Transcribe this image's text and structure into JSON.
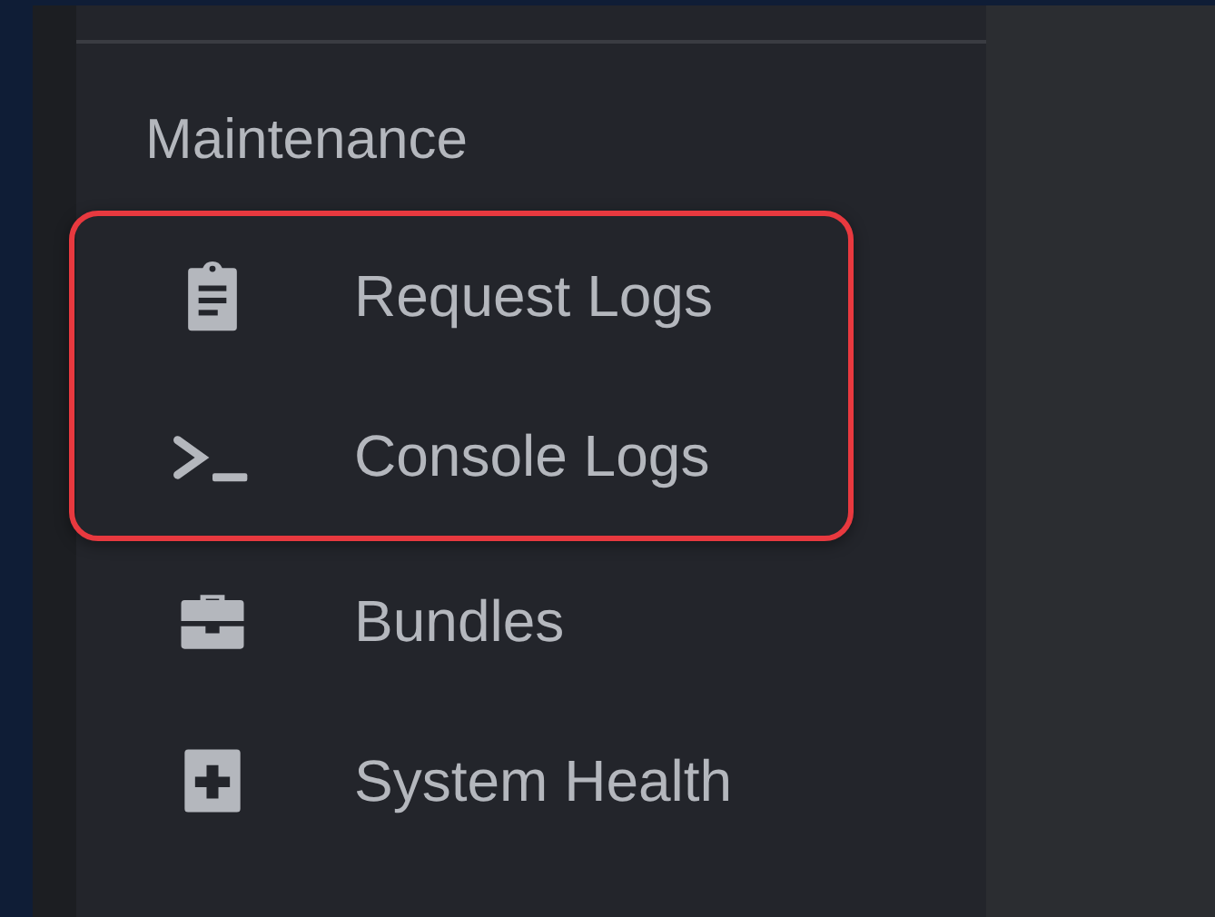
{
  "sidebar": {
    "section_title": "Maintenance",
    "highlighted_items": [
      {
        "label": "Request Logs",
        "kind": "clipboard"
      },
      {
        "label": "Console Logs",
        "kind": "terminal"
      }
    ],
    "items": [
      {
        "label": "Bundles",
        "kind": "toolbox"
      },
      {
        "label": "System Health",
        "kind": "medical"
      }
    ]
  }
}
